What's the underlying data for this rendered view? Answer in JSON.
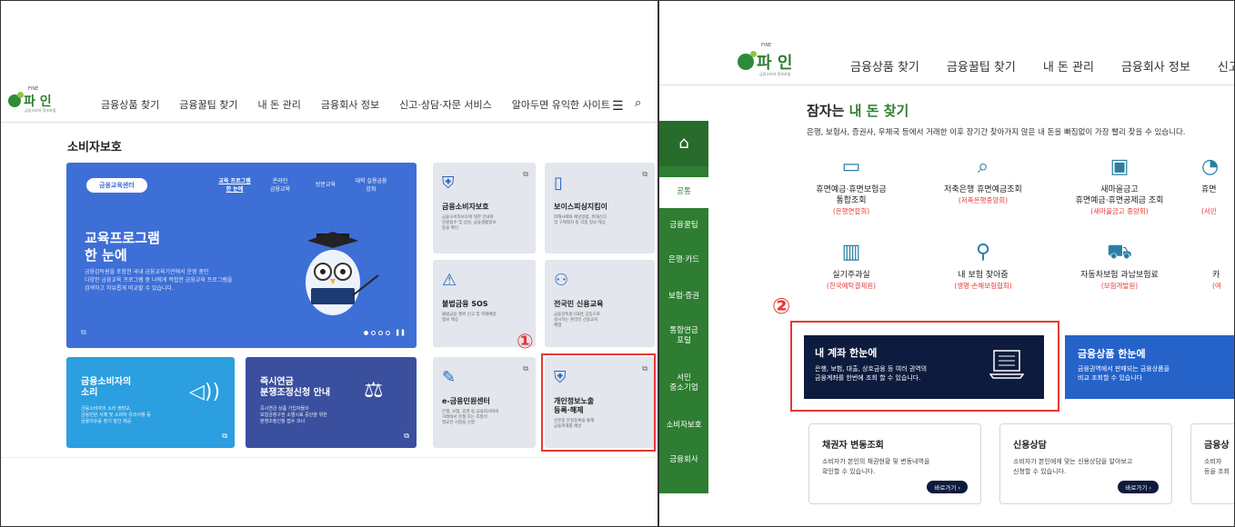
{
  "left": {
    "logo": {
      "sup": "FINE",
      "text": "파 인",
      "sub": "금융소비자 정보포털"
    },
    "nav": [
      "금융상품 찾기",
      "금융꿀팁 찾기",
      "내 돈 관리",
      "금융회사 정보",
      "신고·상담·자문 서비스",
      "알아두면 유익한 사이트"
    ],
    "page_title": "소비자보호",
    "big_card": {
      "pill": "금융교육센터",
      "tabs": [
        "교육 프로그램\n한 눈에",
        "온라인\n금융교육",
        "방문교육",
        "대학 실용금융\n강좌"
      ],
      "heading_1": "교육프로그램",
      "heading_2": "한 눈에",
      "desc": "금융감독원을 포함한 국내 금융교육기관에서 운영 중인\n다양한 금융교육 프로그램 중 나에게 적합한 금융교육 프로그램을\n검색하고 자유롭게 비교할 수 있습니다."
    },
    "grey_cards": [
      {
        "title": "금융소비자보호",
        "desc": "금융소비자보호에 대한 안내와\n민원접수 및 상담, 금융생활정보\n등을 확인"
      },
      {
        "title": "보이스피싱지킴이",
        "desc": "피해사례와 예방방법, 피해신고\n및 구제절차 등 각종 정보 제공"
      },
      {
        "title": "불법금융 SOS",
        "desc": "불법금융 행위 신고 및 피해예방\n정보 제공"
      },
      {
        "title": "전국민 신용교육",
        "desc": "금융감독원·CB社 공동으로\n실시하는 온라인 신용교육\n체험"
      },
      {
        "title": "e-금융민원센터",
        "desc": "은행, 보험, 증권 등 금융회사와의\n거래에서 분쟁 또는 조정이\n필요한 사항을 신청"
      },
      {
        "title": "개인정보노출\n등록·해제",
        "desc": "신분증 분실등록을 통해\n금융피해를 예방"
      }
    ],
    "blue_cards": [
      {
        "title": "금융소비자의\n소리",
        "desc": "금융소비자의 소리 쌍방교,\n금융민원 사례 및 소비자 유의사항 등\n금융이슈를 정기 발간 제공"
      },
      {
        "title": "즉시연금\n분쟁조정신청 안내",
        "desc": "즉시연금 상품 가입자들의\n보험금청구권 소멸시효 중단을 위한\n분쟁조정신청 접수 코너"
      }
    ],
    "marker": "①"
  },
  "right": {
    "logo": {
      "sup": "FINE",
      "text": "파 인",
      "sub": "금융소비자 정보포털"
    },
    "nav": [
      "금융상품 찾기",
      "금융꿀팁 찾기",
      "내 돈 관리",
      "금융회사 정보",
      "신고"
    ],
    "sidebar": [
      "공통",
      "금융꿀팁",
      "은행·카드",
      "보험·증권",
      "통합연금\n포털",
      "서민\n중소기업",
      "소비자보호",
      "금융회사"
    ],
    "title_prefix": "잠자는 ",
    "title_highlight": "내 돈 찾기",
    "desc": "은행, 보험사, 증권사, 우체국 등에서 거래한 이후 장기간 찾아가지 않은 내 돈을 빠짐없이 가장 빨리 찾을 수 있습니다.",
    "services": [
      {
        "name": "휴면예금·휴면보험금\n통합조회",
        "org": "(은행연합회)"
      },
      {
        "name": "저축은행 휴면예금조회",
        "org": "(저축은행중앙회)"
      },
      {
        "name": "새마을금고\n휴면예금·휴면공제금 조회",
        "org": "(새마을금고 중앙회)"
      },
      {
        "name": "휴면",
        "org": "(서민"
      },
      {
        "name": "실기주과실",
        "org": "(한국예탁결제원)"
      },
      {
        "name": "내 보험 찾아줌",
        "org": "(생명·손해보험협회)"
      },
      {
        "name": "자동차보험 과납보험료",
        "org": "(보험개발원)"
      },
      {
        "name": "카",
        "org": "(여"
      }
    ],
    "account_block": {
      "title": "내 계좌 한눈에",
      "desc": "은행, 보험, 대출, 상호금융 등 여러 권역의\n금융계좌를 한번에 조회 할 수 있습니다."
    },
    "product_block": {
      "title": "금융상품 한눈에",
      "desc": "금융권역에서 판매되는 금융상품을\n비교 조회할 수 있습니다"
    },
    "cards": [
      {
        "title": "채권자 변동조회",
        "desc": "소비자가 본인의 채권현황 및 변동내역을\n확인할 수 있습니다.",
        "btn": "바로가기 ›"
      },
      {
        "title": "신용상담",
        "desc": "소비자가 본인에게 맞는 신용상담을 알아보고\n신청할 수 있습니다.",
        "btn": "바로가기 ›"
      },
      {
        "title": "금융상",
        "desc": "소비자\n등을 조회",
        "btn": ""
      }
    ],
    "marker": "②"
  },
  "colors": {
    "green": "#2e7d32",
    "blue": "#3d6fd6",
    "navy": "#0d1b3e",
    "red": "#e53935"
  }
}
